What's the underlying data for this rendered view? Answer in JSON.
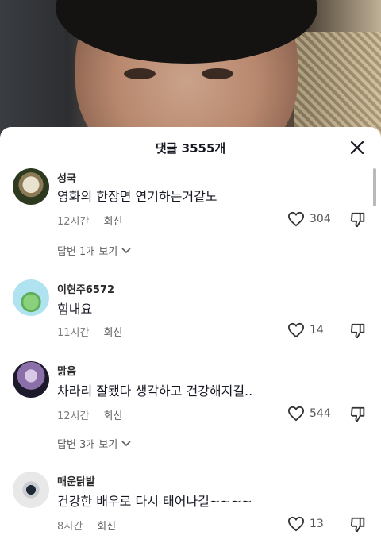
{
  "sheet": {
    "title": "댓글 3555개"
  },
  "icons": {
    "close": "close-icon",
    "like": "heart-outline-icon",
    "dislike": "thumbs-down-icon",
    "expand": "chevron-down-icon"
  },
  "colors": {
    "text_primary": "#161823",
    "text_secondary": "#7b7b7b",
    "sheet_bg": "#ffffff"
  },
  "comments": [
    {
      "username": "성국",
      "text": "영화의 한장면 연기하는거같노",
      "time": "12시간",
      "reply_label": "회신",
      "likes": "304",
      "view_replies": "답변 1개 보기"
    },
    {
      "username": "이현주6572",
      "text": "힘내요",
      "time": "11시간",
      "reply_label": "회신",
      "likes": "14"
    },
    {
      "username": "맑음",
      "text": "차라리 잘됐다 생각하고 건강해지길..",
      "time": "12시간",
      "reply_label": "회신",
      "likes": "544",
      "view_replies": "답변 3개 보기"
    },
    {
      "username": "매운닭발",
      "text": "건강한 배우로 다시 태어나길~~~~",
      "time": "8시간",
      "reply_label": "회신",
      "likes": "13"
    }
  ]
}
